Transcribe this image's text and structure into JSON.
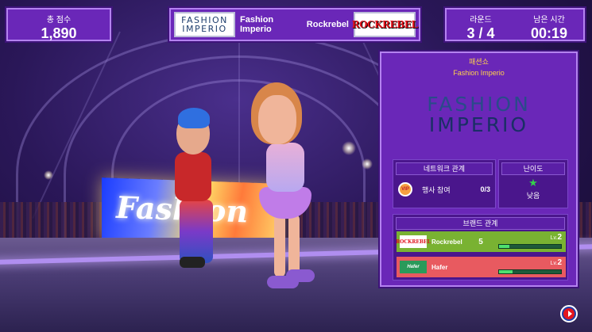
{
  "hud": {
    "score_label": "총 점수",
    "score_value": "1,890",
    "left_brand": "Fashion Imperio",
    "left_logo_line1": "FASHION",
    "left_logo_line2": "IMPERIO",
    "right_brand": "Rockrebel",
    "right_logo": "ROCKREBEL",
    "round_label": "라운드",
    "round_value": "3 / 4",
    "time_label": "남은 시간",
    "time_value": "00:19"
  },
  "scene": {
    "screen_text": "Fashion"
  },
  "panel": {
    "title": "패션쇼",
    "subtitle": "Fashion Imperio",
    "logo_line1": "FASHION",
    "logo_line2": "IMPERIO",
    "network": {
      "header": "네트워크 관계",
      "vip_icon_text": "VIP",
      "label": "행사 참여",
      "count": "0/3"
    },
    "difficulty": {
      "header": "난이도",
      "value": "낮음",
      "star_color": "#33d14a"
    },
    "brand_relations": {
      "header": "브랜드 관계",
      "rows": [
        {
          "logo": "ROCKREBEL",
          "name": "Rockrebel",
          "number": "5",
          "level_prefix": "Lv.",
          "level": "2",
          "progress": 0.17,
          "color": "#79b232"
        },
        {
          "logo": "Hafer",
          "name": "Hafer",
          "number": "",
          "level_prefix": "Lv.",
          "level": "2",
          "progress": 0.22,
          "color": "#e85a60"
        }
      ]
    }
  },
  "icons": {
    "vip": "vip-badge-icon",
    "star": "star-icon",
    "next": "next-play-icon"
  }
}
